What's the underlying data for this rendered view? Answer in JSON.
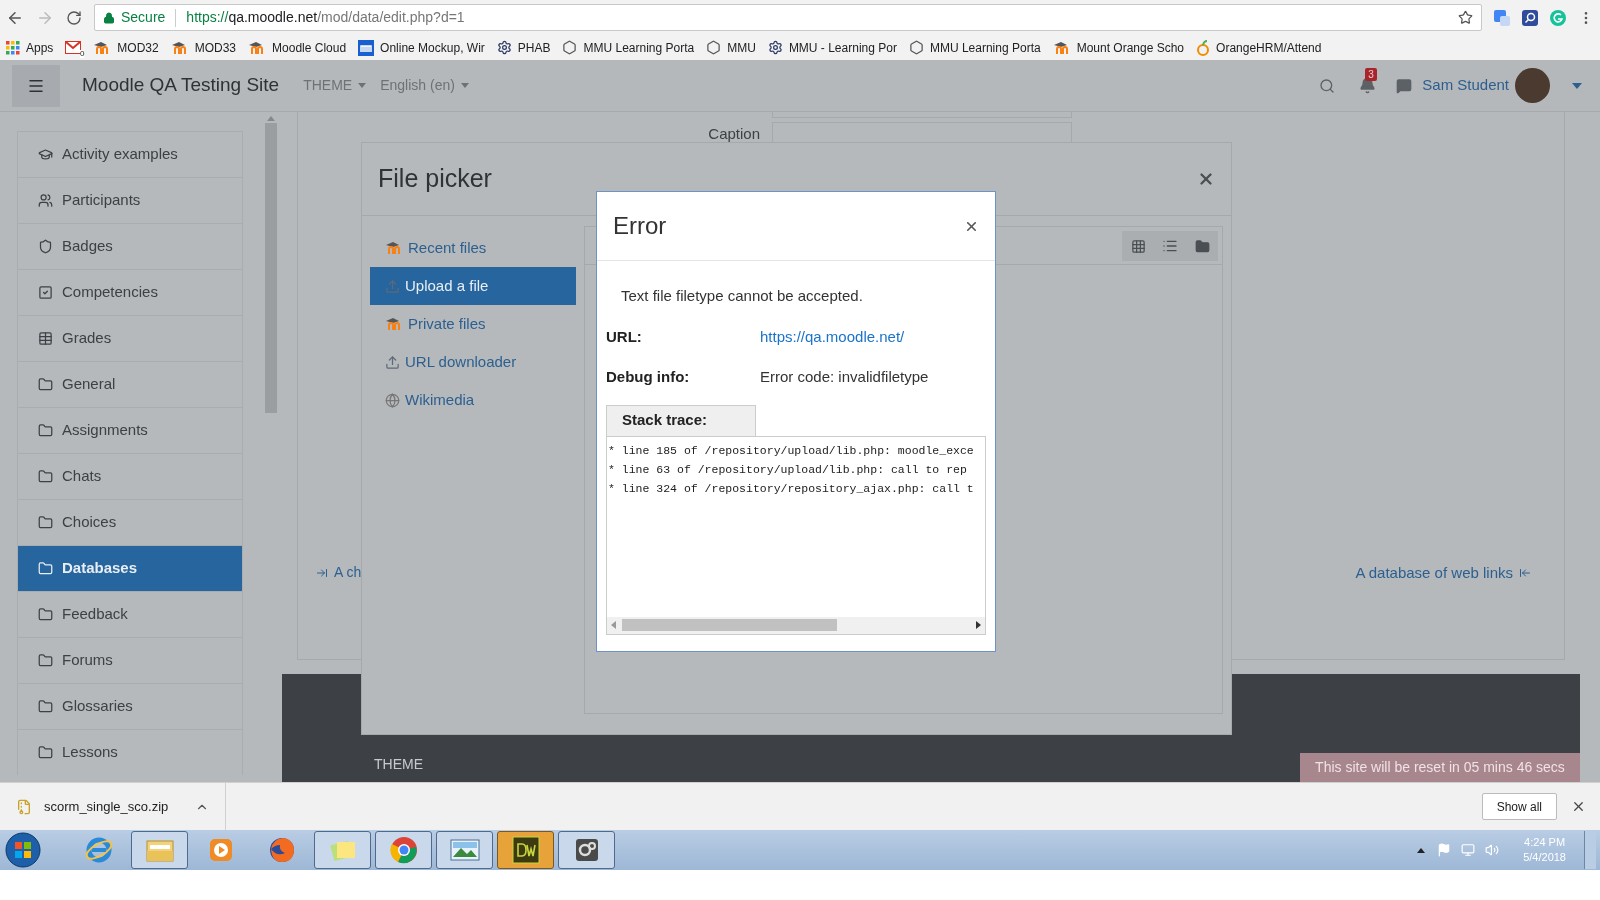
{
  "browser": {
    "security_label": "Secure",
    "url": {
      "scheme": "https://",
      "host": "qa.moodle.net",
      "path": "/mod/data/edit.php?d=1"
    },
    "bookmarks": [
      {
        "kind": "apps",
        "label": "Apps"
      },
      {
        "kind": "gmail",
        "badge": "0"
      },
      {
        "kind": "moodle",
        "label": "MOD32"
      },
      {
        "kind": "moodle",
        "label": "MOD33"
      },
      {
        "kind": "moodle",
        "label": "Moodle Cloud"
      },
      {
        "kind": "m-square",
        "label": "Online Mockup, Wir"
      },
      {
        "kind": "gear",
        "label": "PHAB"
      },
      {
        "kind": "hexagon",
        "label": "MMU Learning Porta"
      },
      {
        "kind": "hexagon",
        "label": "MMU"
      },
      {
        "kind": "gear",
        "label": "MMU - Learning Por"
      },
      {
        "kind": "hexagon",
        "label": "MMU Learning Porta"
      },
      {
        "kind": "moodle",
        "label": "Mount Orange Scho"
      },
      {
        "kind": "orange",
        "label": "OrangeHRM/Attend"
      }
    ]
  },
  "header": {
    "site_name": "Moodle QA Testing Site",
    "menus": [
      "THEME",
      "English (en)"
    ],
    "notification_count": "3",
    "user_name": "Sam Student"
  },
  "sidebar": {
    "items": [
      {
        "kind": "cap",
        "label": "Activity examples",
        "selected": false
      },
      {
        "kind": "users",
        "label": "Participants",
        "selected": false
      },
      {
        "kind": "shield",
        "label": "Badges",
        "selected": false
      },
      {
        "kind": "check",
        "label": "Competencies",
        "selected": false
      },
      {
        "kind": "table",
        "label": "Grades",
        "selected": false
      },
      {
        "kind": "folder",
        "label": "General",
        "selected": false
      },
      {
        "kind": "folder",
        "label": "Assignments",
        "selected": false
      },
      {
        "kind": "folder",
        "label": "Chats",
        "selected": false
      },
      {
        "kind": "folder",
        "label": "Choices",
        "selected": false
      },
      {
        "kind": "folder",
        "label": "Databases",
        "selected": true
      },
      {
        "kind": "folder",
        "label": "Feedback",
        "selected": false
      },
      {
        "kind": "folder",
        "label": "Forums",
        "selected": false
      },
      {
        "kind": "folder",
        "label": "Glossaries",
        "selected": false
      },
      {
        "kind": "folder",
        "label": "Lessons",
        "selected": false
      }
    ]
  },
  "form": {
    "caption_label": "Caption"
  },
  "activity_nav": {
    "previous": "A ch",
    "next": "A database of web links"
  },
  "footer": {
    "heading": "THEME",
    "reset_notice": "This site will be reset in 05 mins 46 secs"
  },
  "file_picker": {
    "title": "File picker",
    "repositories": [
      {
        "kind": "moodle",
        "label": "Recent files",
        "selected": false
      },
      {
        "kind": "upload",
        "label": "Upload a file",
        "selected": true
      },
      {
        "kind": "moodle",
        "label": "Private files",
        "selected": false
      },
      {
        "kind": "upload",
        "label": "URL downloader",
        "selected": false
      },
      {
        "kind": "globe",
        "label": "Wikimedia",
        "selected": false
      }
    ]
  },
  "error_dialog": {
    "title": "Error",
    "message": "Text file filetype cannot be accepted.",
    "fields": [
      {
        "label": "URL:",
        "value": "https://qa.moodle.net/",
        "kind": "link"
      },
      {
        "label": "Debug info:",
        "value": "Error code: invalidfiletype",
        "kind": "text"
      }
    ],
    "stack_trace": {
      "label": "Stack trace:",
      "lines": [
        "* line 185 of /repository/upload/lib.php: moodle_exce",
        "* line 63 of /repository/upload/lib.php: call to rep",
        "* line 324 of /repository/repository_ajax.php: call t"
      ]
    }
  },
  "downloads": {
    "file_name": "scorm_single_sco.zip",
    "show_all": "Show all"
  },
  "taskbar": {
    "apps": [
      {
        "kind": "ie",
        "running": false
      },
      {
        "kind": "explorer",
        "running": true
      },
      {
        "kind": "media",
        "running": false
      },
      {
        "kind": "firefox",
        "running": false
      },
      {
        "kind": "notes",
        "running": true
      },
      {
        "kind": "chrome",
        "running": true
      },
      {
        "kind": "photos",
        "running": true
      },
      {
        "kind": "dreamweaver",
        "running": true
      },
      {
        "kind": "tool",
        "running": true
      }
    ],
    "time": "4:24 PM",
    "date": "5/4/2018"
  }
}
